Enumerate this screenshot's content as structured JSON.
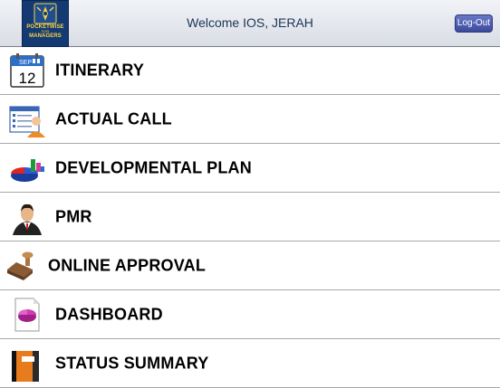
{
  "header": {
    "logo": {
      "title": "POCKETWISE",
      "subtitle_for": "FOR",
      "subtitle": "MANAGERS"
    },
    "welcome_prefix": "Welcome",
    "user_name": "IOS, JERAH",
    "logout_label": "Log-Out"
  },
  "menu": {
    "items": [
      {
        "label": "ITINERARY",
        "icon": "calendar-icon",
        "calendar_month": "SEP",
        "calendar_day": "12"
      },
      {
        "label": "ACTUAL CALL",
        "icon": "doctor-list-icon"
      },
      {
        "label": "DEVELOPMENTAL PLAN",
        "icon": "pie-chart-icon"
      },
      {
        "label": "PMR",
        "icon": "businessman-icon"
      },
      {
        "label": "ONLINE APPROVAL",
        "icon": "stamp-icon"
      },
      {
        "label": "DASHBOARD",
        "icon": "document-chart-icon"
      },
      {
        "label": "STATUS SUMMARY",
        "icon": "notebook-icon"
      }
    ]
  }
}
